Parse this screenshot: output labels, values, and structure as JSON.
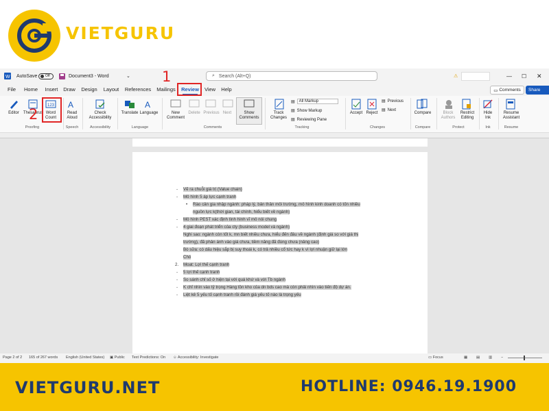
{
  "banner": {
    "brand": "VIETGURU",
    "website": "VIETGURU.NET",
    "hotline": "HOTLINE: 0946.19.1900"
  },
  "titlebar": {
    "autosave_label": "AutoSave",
    "autosave_state": "Off",
    "doc_title": "Document3 - Word",
    "search_placeholder": "Search (Alt+Q)"
  },
  "tabs": [
    "File",
    "Home",
    "Insert",
    "Draw",
    "Design",
    "Layout",
    "References",
    "Mailings",
    "Review",
    "View",
    "Help"
  ],
  "active_tab": "Review",
  "header_buttons": {
    "comments": "Comments",
    "share": "Share"
  },
  "annotations": {
    "one": "1",
    "two": "2"
  },
  "ribbon": {
    "proofing": {
      "editor": "Editor",
      "thesaurus": "Thesaurus",
      "word_count_1": "Word",
      "word_count_2": "Count",
      "label": "Proofing"
    },
    "speech": {
      "read_1": "Read",
      "read_2": "Aloud",
      "label": "Speech"
    },
    "accessibility": {
      "check_1": "Check",
      "check_2": "Accessibility",
      "label": "Accessibility"
    },
    "language": {
      "translate": "Translate",
      "language": "Language",
      "label": "Language"
    },
    "comments": {
      "new_1": "New",
      "new_2": "Comment",
      "delete": "Delete",
      "previous": "Previous",
      "next": "Next",
      "show_1": "Show",
      "show_2": "Comments",
      "label": "Comments"
    },
    "tracking": {
      "track_1": "Track",
      "track_2": "Changes",
      "all_markup": "All Markup",
      "show_markup": "Show Markup",
      "reviewing_pane": "Reviewing Pane",
      "label": "Tracking"
    },
    "changes": {
      "accept": "Accept",
      "reject": "Reject",
      "previous": "Previous",
      "next": "Next",
      "label": "Changes"
    },
    "compare": {
      "compare": "Compare",
      "label": "Compare"
    },
    "protect": {
      "block_1": "Block",
      "block_2": "Authors",
      "restrict_1": "Restrict",
      "restrict_2": "Editing",
      "label": "Protect"
    },
    "ink": {
      "hide_1": "Hide",
      "hide_2": "Ink",
      "label": "Ink"
    },
    "resume": {
      "resume_1": "Resume",
      "resume_2": "Assistant",
      "label": "Resume"
    }
  },
  "document_lines": [
    {
      "marker": "-",
      "text": "Vẽ ra chuỗi giá trị (Value chain)"
    },
    {
      "marker": "-",
      "text": "Mô hình 5 áp lực cạnh tranh"
    },
    {
      "marker": "•",
      "text": "Rào cản gia nhập ngành: pháp lý, bản thân môi trường, mô hình kinh doanh có tốn nhiều"
    },
    {
      "marker": "",
      "text": "nguồn lực k(thời gian, tài chính, hiểu biết về ngành)"
    },
    {
      "marker": "-",
      "text": "Mô hình PEST xác định tình hình vĩ mô nói chung"
    },
    {
      "marker": "-",
      "text": "4 giai đoạn phát triển của cty (business model và ngành)"
    },
    {
      "marker": "",
      "text": "Nghi sao: ngành còn tốt k, mn biết nhiều chưa, hiểu đến đâu về ngành (định giá so với giá thị"
    },
    {
      "marker": "",
      "text": "trường), đã phản ánh vào giá chưa, tiềm năng đã đúng chưa (nâng cao)"
    },
    {
      "marker": "",
      "text": "Bò sữa: có dấu hiệu sắp bị suy thoái k, có trả nhiều cổ tức hay k vì lợi nhuận giữ lại lớn"
    },
    {
      "marker": "",
      "text": "Chó"
    },
    {
      "marker": "2.",
      "text": "Moat: Lợi thế cạnh tranh"
    },
    {
      "marker": "-",
      "text": "5 lợi thế cạnh tranh"
    },
    {
      "marker": "-",
      "text": "So sánh chỉ số ở hiện tại với quá khứ và với Tb ngành"
    },
    {
      "marker": "-",
      "text": "K chỉ nhìn vào tỷ trọng Hàng tồn kho của dn bds cao mà còn phải nhìn vào tiến độ dự án."
    },
    {
      "marker": "-",
      "text": "Liệt kê 5 yếu tố cạnh tranh rồi đánh giá yếu tố nào là trọng yếu"
    }
  ],
  "status": {
    "page": "Page 2 of 2",
    "words": "165 of 267 words",
    "language": "English (United States)",
    "sensitivity": "Public",
    "predictions": "Text Predictions: On",
    "accessibility": "Accessibility: Investigate",
    "focus": "Focus"
  },
  "colors": {
    "brand_yellow": "#f6c400",
    "brand_blue": "#1f3a6e",
    "word_blue": "#185abd",
    "annotation_red": "#e02424"
  }
}
